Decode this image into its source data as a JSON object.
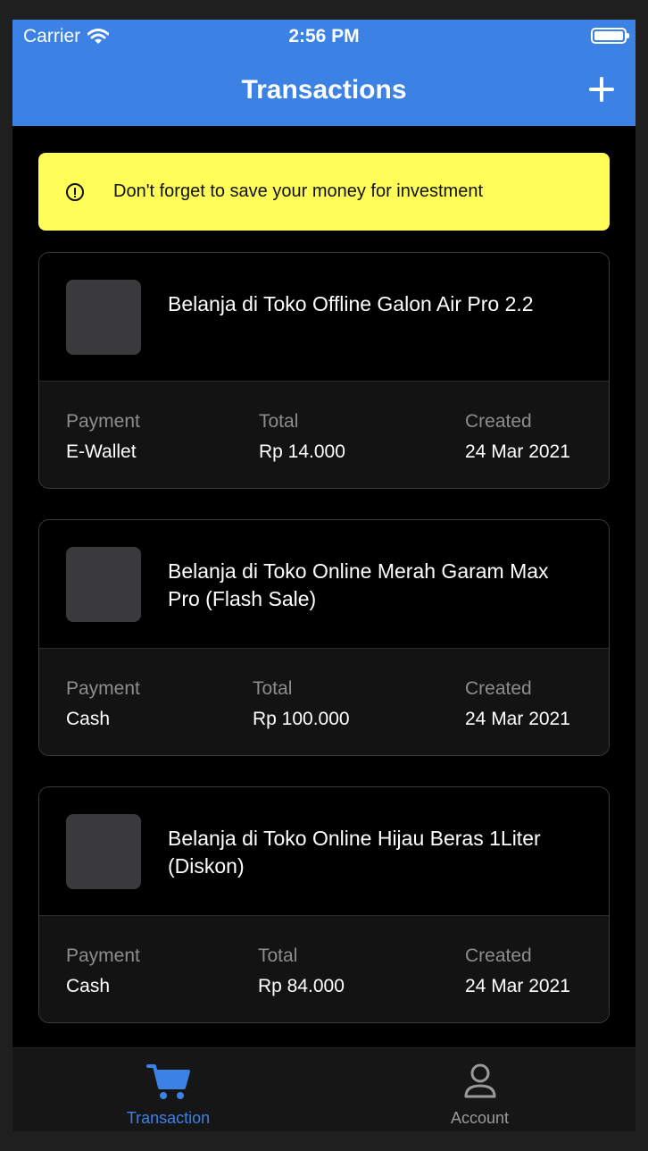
{
  "status_bar": {
    "carrier": "Carrier",
    "time": "2:56 PM"
  },
  "header": {
    "title": "Transactions",
    "add_icon": "plus-icon"
  },
  "banner": {
    "text": "Don't forget to save your money for investment",
    "icon": "info-icon",
    "color": "#fffd57"
  },
  "transactions": [
    {
      "title": "Belanja di Toko Offline Galon Air Pro 2.2",
      "payment_label": "Payment",
      "payment": "E-Wallet",
      "total_label": "Total",
      "total": "Rp 14.000",
      "created_label": "Created",
      "created": "24 Mar 2021"
    },
    {
      "title": "Belanja di Toko Online Merah Garam Max Pro (Flash Sale)",
      "payment_label": "Payment",
      "payment": "Cash",
      "total_label": "Total",
      "total": "Rp 100.000",
      "created_label": "Created",
      "created": "24 Mar 2021"
    },
    {
      "title": "Belanja di Toko Online Hijau Beras 1Liter (Diskon)",
      "payment_label": "Payment",
      "payment": "Cash",
      "total_label": "Total",
      "total": "Rp 84.000",
      "created_label": "Created",
      "created": "24 Mar 2021"
    }
  ],
  "tabbar": {
    "tabs": [
      {
        "label": "Transaction",
        "icon": "cart-icon",
        "active": true
      },
      {
        "label": "Account",
        "icon": "user-icon",
        "active": false
      }
    ]
  },
  "colors": {
    "accent": "#3b82e4",
    "active_tab": "#3b82e4",
    "inactive_tab": "#9a9a9a"
  }
}
